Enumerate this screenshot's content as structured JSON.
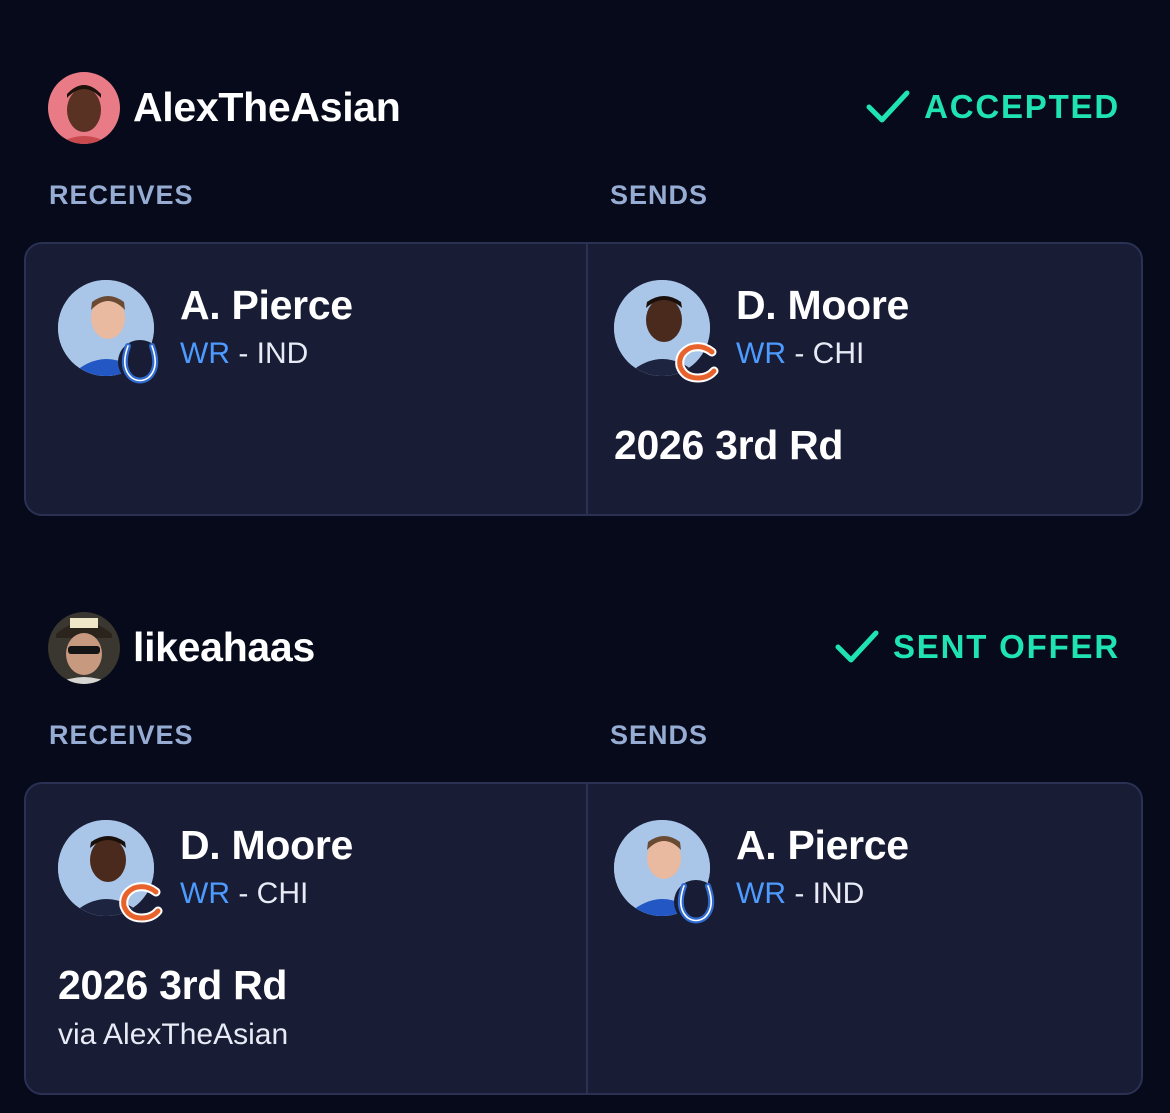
{
  "trades": [
    {
      "user": {
        "name": "AlexTheAsian",
        "avatar_icon": "user-avatar-icon"
      },
      "status": "ACCEPTED",
      "status_color": "#20e3b2",
      "receives_label": "RECEIVES",
      "sends_label": "SENDS",
      "receives": {
        "player": {
          "name": "A. Pierce",
          "position": "WR",
          "sep": " - ",
          "team": "IND",
          "team_logo": "colts-horseshoe-icon"
        }
      },
      "sends": {
        "player": {
          "name": "D. Moore",
          "position": "WR",
          "sep": " - ",
          "team": "CHI",
          "team_logo": "bears-c-icon"
        },
        "pick": "2026 3rd Rd"
      }
    },
    {
      "user": {
        "name": "likeahaas",
        "avatar_icon": "user-avatar-icon"
      },
      "status": "SENT OFFER",
      "status_color": "#20e3b2",
      "receives_label": "RECEIVES",
      "sends_label": "SENDS",
      "receives": {
        "player": {
          "name": "D. Moore",
          "position": "WR",
          "sep": " - ",
          "team": "CHI",
          "team_logo": "bears-c-icon"
        },
        "pick": "2026 3rd Rd",
        "pick_via": "via AlexTheAsian"
      },
      "sends": {
        "player": {
          "name": "A. Pierce",
          "position": "WR",
          "sep": " - ",
          "team": "IND",
          "team_logo": "colts-horseshoe-icon"
        }
      }
    }
  ]
}
